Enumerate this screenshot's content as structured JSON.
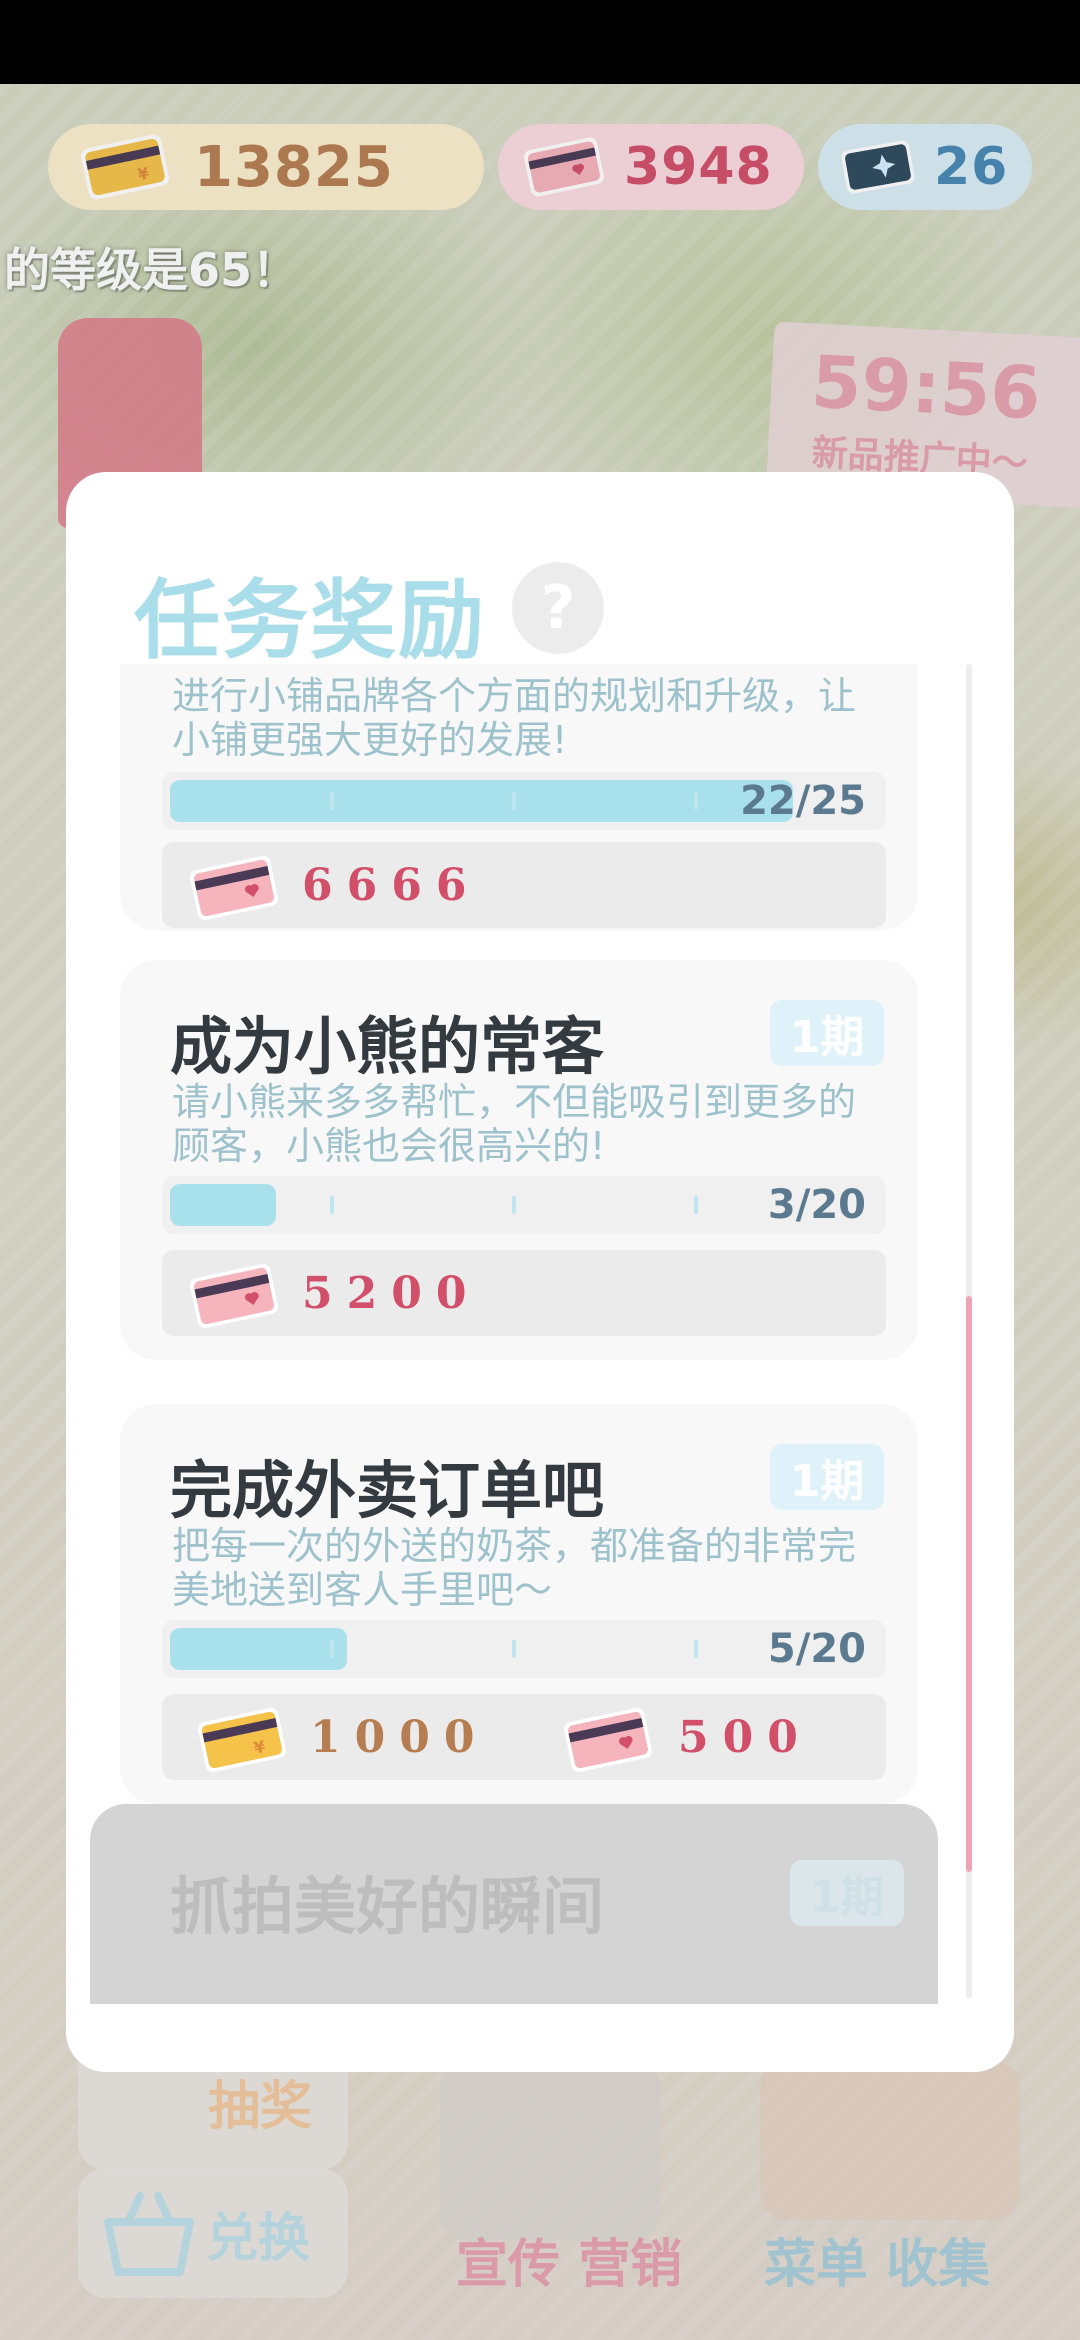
{
  "currencies": {
    "gold": "13825",
    "pink": "3948",
    "blue": "26"
  },
  "background": {
    "level_text": "的等级是65！",
    "timer_time": "59:56",
    "timer_label": "新品推广中～",
    "bottom_left_1": "抽奖",
    "bottom_left_2": "兑换",
    "bottom_mid": "宣传 营销",
    "bottom_right": "菜单 收集"
  },
  "modal": {
    "title": "任务奖励",
    "help_glyph": "?",
    "tasks": [
      {
        "desc": "进行小铺品牌各个方面的规划和升级，让小铺更强大更好的发展!",
        "progress_text": "22/25",
        "progress": 0.88,
        "rewards": [
          {
            "type": "pink-ticket",
            "amount": "6666"
          }
        ]
      },
      {
        "title": "成为小熊的常客",
        "period": "1期",
        "desc": "请小熊来多多帮忙，不但能吸引到更多的顾客，小熊也会很高兴的!",
        "progress_text": "3/20",
        "progress": 0.15,
        "rewards": [
          {
            "type": "pink-ticket",
            "amount": "5200"
          }
        ]
      },
      {
        "title": "完成外卖订单吧",
        "period": "1期",
        "desc": "把每一次的外送的奶茶，都准备的非常完美地送到客人手里吧～",
        "progress_text": "5/20",
        "progress": 0.25,
        "rewards": [
          {
            "type": "gold-ticket",
            "amount": "1000"
          },
          {
            "type": "pink-ticket",
            "amount": "500"
          }
        ]
      },
      {
        "title": "抓拍美好的瞬间",
        "period": "1期"
      }
    ]
  },
  "colors": {
    "title": "#a9dde9",
    "progress_fill": "#a8e0ec",
    "pink_amount": "#d24f6a",
    "gold_amount": "#b67d51",
    "scroll_thumb": "#f1a3b6"
  }
}
